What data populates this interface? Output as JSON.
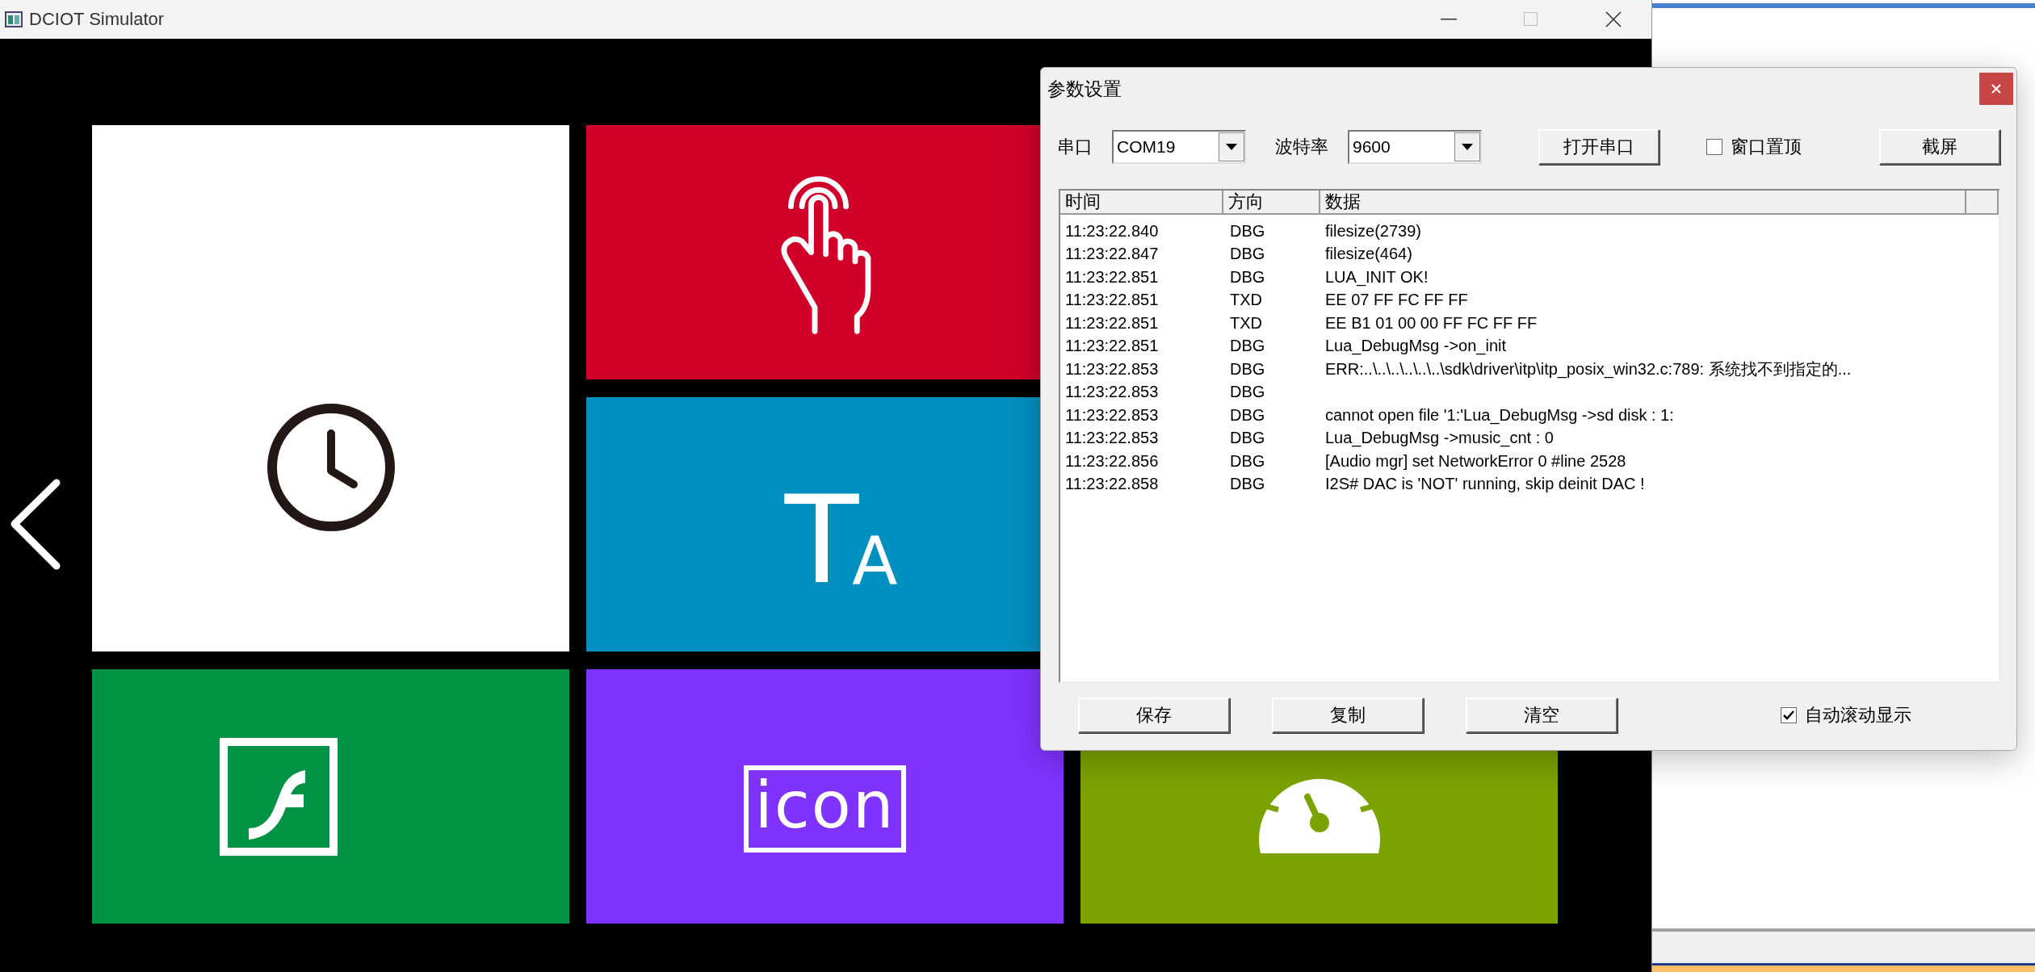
{
  "simulator": {
    "title": "DCIOT Simulator",
    "tiles": [
      {
        "kind": "clock"
      },
      {
        "kind": "touch"
      },
      {
        "kind": "text",
        "glyph_large": "T",
        "glyph_small": "A"
      },
      {
        "kind": "flash"
      },
      {
        "kind": "label",
        "label": "icon"
      },
      {
        "kind": "gauge"
      }
    ]
  },
  "dialog": {
    "title": "参数设置",
    "port_label": "串口",
    "port_value": "COM19",
    "baud_label": "波特率",
    "baud_value": "9600",
    "open_button": "打开串口",
    "topmost": {
      "label": "窗口置顶",
      "checked": false
    },
    "screenshot_button": "截屏",
    "columns": [
      "时间",
      "方向",
      "数据"
    ],
    "rows": [
      {
        "time": "11:23:22.840",
        "direction": "DBG",
        "data": "filesize(2739)"
      },
      {
        "time": "11:23:22.847",
        "direction": "DBG",
        "data": "filesize(464)"
      },
      {
        "time": "11:23:22.851",
        "direction": "DBG",
        "data": "LUA_INIT OK!"
      },
      {
        "time": "11:23:22.851",
        "direction": "TXD",
        "data": "EE 07 FF FC FF FF"
      },
      {
        "time": "11:23:22.851",
        "direction": "TXD",
        "data": "EE B1 01 00 00 FF FC FF FF"
      },
      {
        "time": "11:23:22.851",
        "direction": "DBG",
        "data": "Lua_DebugMsg ->on_init"
      },
      {
        "time": "11:23:22.853",
        "direction": "DBG",
        "data": "ERR:..\\..\\..\\..\\..\\..\\sdk\\driver\\itp\\itp_posix_win32.c:789: 系统找不到指定的..."
      },
      {
        "time": "11:23:22.853",
        "direction": "DBG"
      },
      {
        "time": "11:23:22.853",
        "direction": "DBG",
        "data": "cannot open file '1:'Lua_DebugMsg ->sd disk : 1:"
      },
      {
        "time": "11:23:22.853",
        "direction": "DBG",
        "data": "Lua_DebugMsg ->music_cnt : 0"
      },
      {
        "time": "11:23:22.856",
        "direction": "DBG",
        "data": "[Audio mgr] set NetworkError 0 #line 2528"
      },
      {
        "time": "11:23:22.858",
        "direction": "DBG",
        "data": "I2S# DAC is 'NOT' running, skip deinit DAC !"
      }
    ],
    "buttons": [
      "保存",
      "复制",
      "清空"
    ],
    "autoscroll": {
      "label": "自动滚动显示",
      "checked": true
    }
  }
}
